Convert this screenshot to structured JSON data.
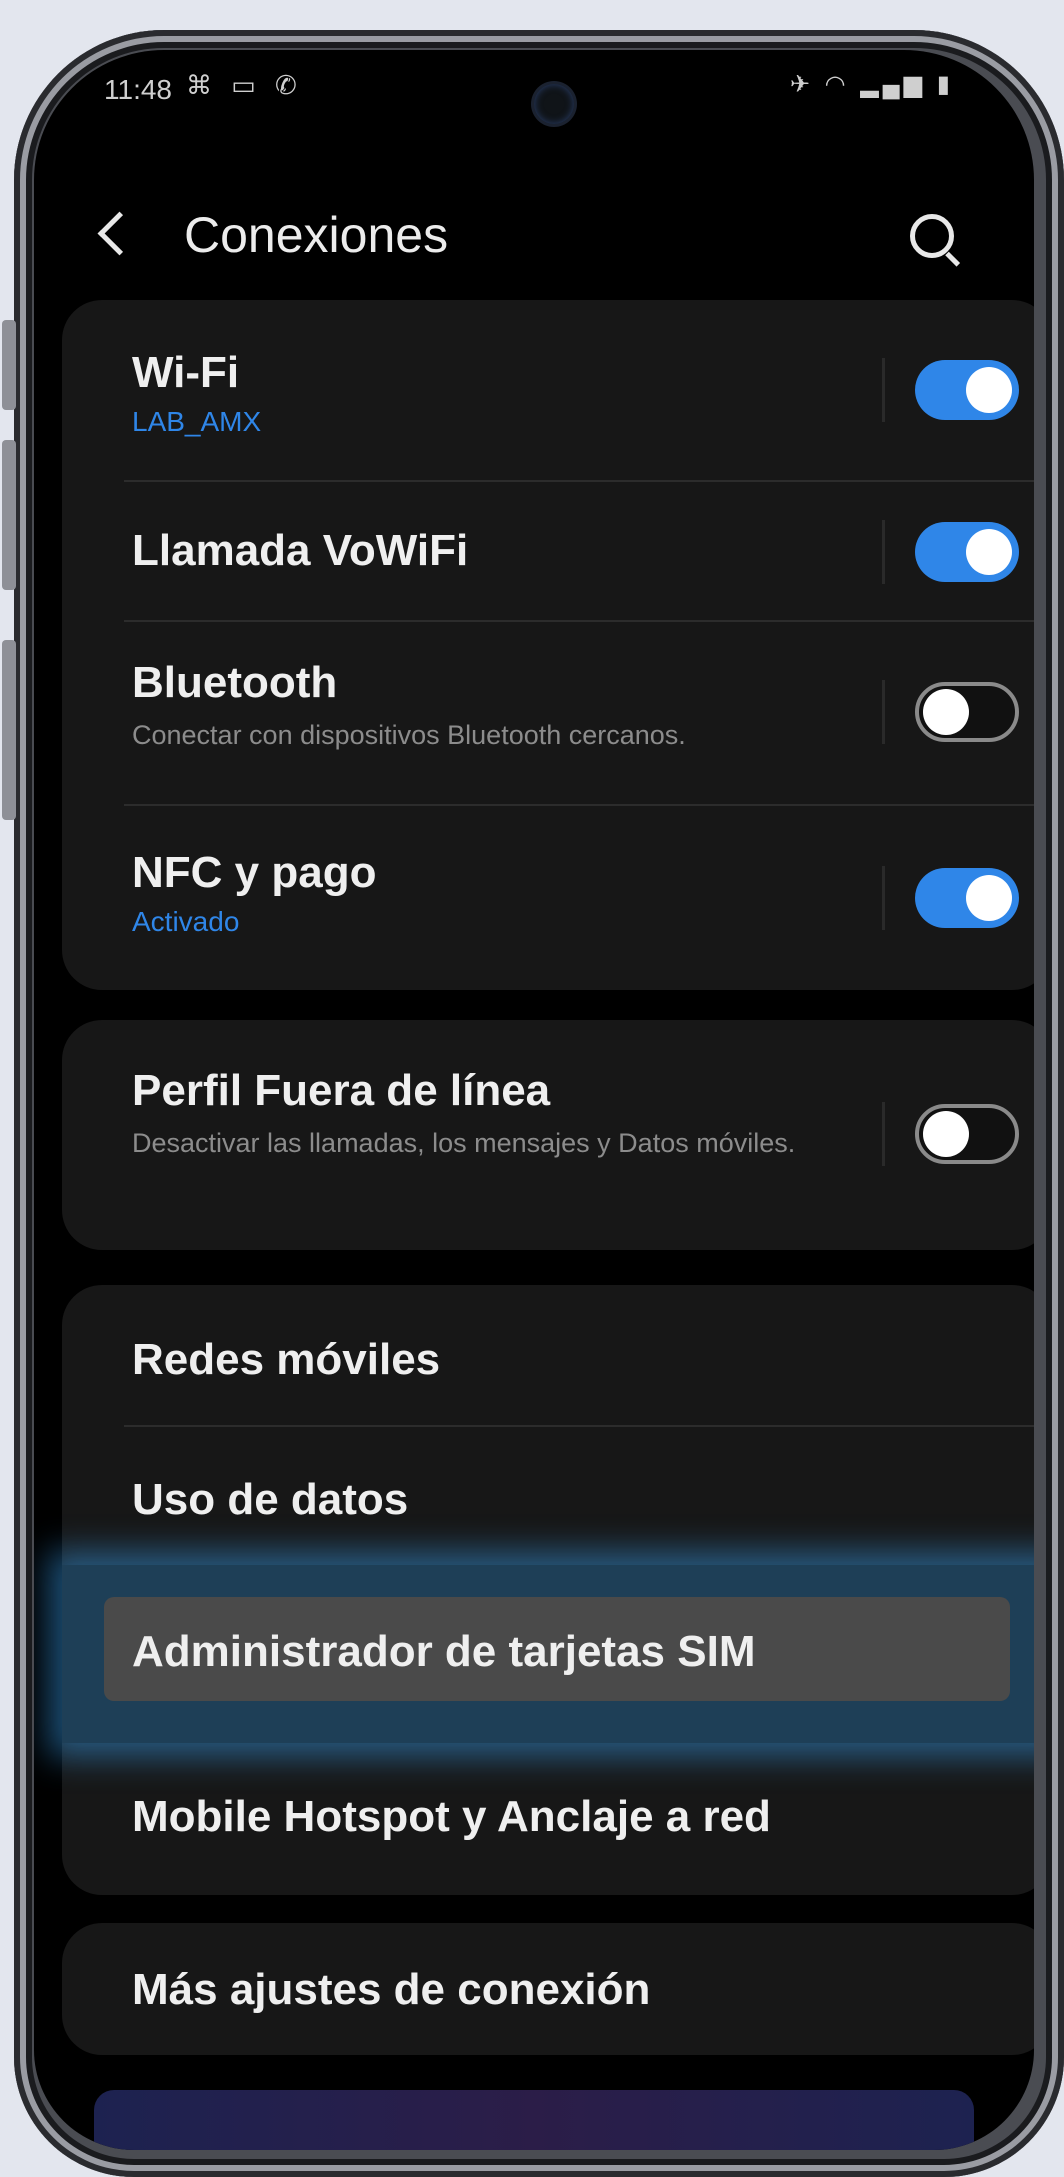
{
  "status_bar": {
    "time": "11:48",
    "left_icons": "⌘ ▭ ✆",
    "right_icons": "✈ ◠ ▂▄▆ ▮"
  },
  "app_bar": {
    "title": "Conexiones"
  },
  "group1": [
    {
      "title": "Wi-Fi",
      "subtitle": "LAB_AMX",
      "toggle_on": true
    },
    {
      "title": "Llamada VoWiFi",
      "toggle_on": true
    },
    {
      "title": "Bluetooth",
      "description": "Conectar con dispositivos Bluetooth cercanos.",
      "toggle_on": false
    },
    {
      "title": "NFC y pago",
      "subtitle": "Activado",
      "toggle_on": true
    }
  ],
  "group2": [
    {
      "title": "Perfil Fuera de línea",
      "description": "Desactivar las llamadas, los mensajes y Datos móviles.",
      "toggle_on": false
    }
  ],
  "group3": [
    {
      "title": "Redes móviles"
    },
    {
      "title": "Uso de datos"
    },
    {
      "title": "Administrador de tarjetas SIM",
      "highlighted": true
    },
    {
      "title": "Mobile Hotspot y Anclaje a red"
    }
  ],
  "group4": [
    {
      "title": "Más ajustes de conexión"
    }
  ],
  "colors": {
    "accent": "#2f86e8",
    "highlight": "#32aaff",
    "background": "#000000",
    "card": "#171717"
  }
}
